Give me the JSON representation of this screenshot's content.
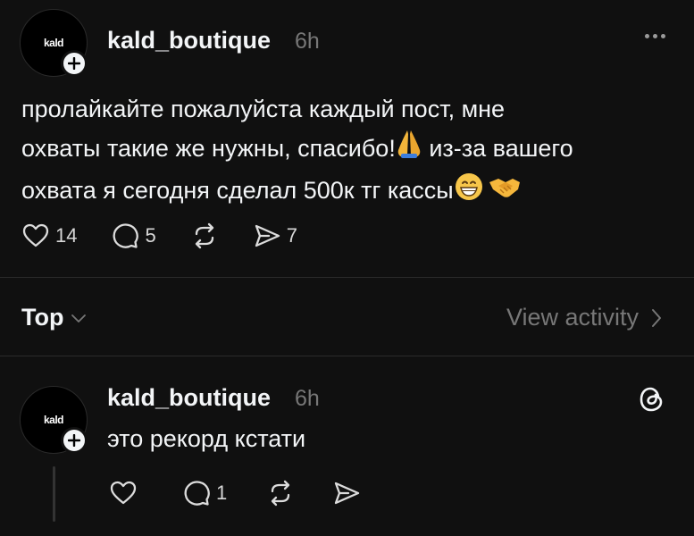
{
  "post": {
    "avatar_text": "kald",
    "username": "kald_boutique",
    "time": "6h",
    "text_line1": "пролайкайте пожалуйста каждый пост, мне",
    "text_line2_a": "охваты такие же нужны, спасибо!",
    "text_line2_b": " из-за вашего",
    "text_line3": "охвата я сегодня сделал 500к тг кассы",
    "likes": "14",
    "comments": "5",
    "shares": "7"
  },
  "sort_bar": {
    "top_label": "Top",
    "view_activity": "View activity"
  },
  "reply": {
    "avatar_text": "kald",
    "username": "kald_boutique",
    "time": "6h",
    "text": "это рекорд кстати",
    "comments": "1"
  },
  "icons": [
    "plus-icon",
    "more-icon",
    "heart-icon",
    "comment-icon",
    "repost-icon",
    "share-icon",
    "chevron-down-icon",
    "chevron-right-icon",
    "threads-logo-icon",
    "pray-emoji",
    "grin-emoji",
    "handshake-emoji"
  ]
}
